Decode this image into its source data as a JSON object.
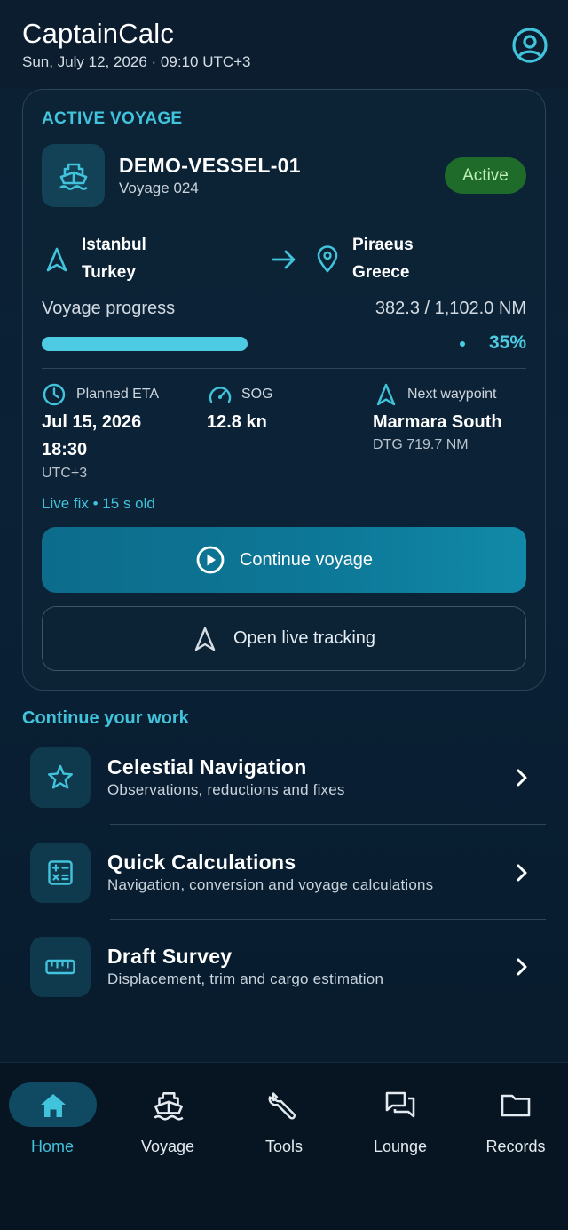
{
  "header": {
    "app_title": "CaptainCalc",
    "datetime": "Sun, July 12, 2026 · 09:10 UTC+3",
    "profile_icon": "user-circle-icon"
  },
  "active_voyage": {
    "section_title": "ACTIVE VOYAGE",
    "vessel_name": "DEMO-VESSEL-01",
    "voyage_number": "Voyage 024",
    "status": "Active",
    "origin": {
      "city": "Istanbul",
      "country": "Turkey"
    },
    "destination": {
      "city": "Piraeus",
      "country": "Greece"
    },
    "progress_label": "Voyage progress",
    "progress_value": "382.3 / 1,102.0 NM",
    "progress_percent_text": "35%",
    "progress_fraction": 0.35,
    "eta_label": "Planned ETA",
    "eta_date": "Jul 15, 2026",
    "eta_time": "18:30",
    "eta_tz": "UTC+3",
    "sog_label": "SOG",
    "sog_value": "12.8 kn",
    "waypoint_label": "Next waypoint",
    "waypoint_name": "Marmara South",
    "waypoint_dtg": "DTG 719.7 NM",
    "live_fix": "Live fix • 15 s old",
    "continue_button": "Continue voyage",
    "tracking_button": "Open live tracking"
  },
  "continue_work": {
    "title": "Continue your work",
    "items": [
      {
        "title": "Celestial Navigation",
        "subtitle": "Observations, reductions and fixes",
        "icon": "star-icon"
      },
      {
        "title": "Quick Calculations",
        "subtitle": "Navigation, conversion and voyage calculations",
        "icon": "calculator-icon"
      },
      {
        "title": "Draft Survey",
        "subtitle": "Displacement, trim and cargo estimation",
        "icon": "ruler-icon"
      }
    ]
  },
  "bottom_nav": {
    "items": [
      {
        "label": "Home",
        "icon": "home-icon",
        "active": true
      },
      {
        "label": "Voyage",
        "icon": "ship-icon",
        "active": false
      },
      {
        "label": "Tools",
        "icon": "wrench-icon",
        "active": false
      },
      {
        "label": "Lounge",
        "icon": "chat-icon",
        "active": false
      },
      {
        "label": "Records",
        "icon": "folder-icon",
        "active": false
      }
    ]
  },
  "colors": {
    "accent": "#42c3dc",
    "status_active_bg": "#1f6b2a",
    "status_active_text": "#bff0b3",
    "primary_button": "#0d7898"
  }
}
